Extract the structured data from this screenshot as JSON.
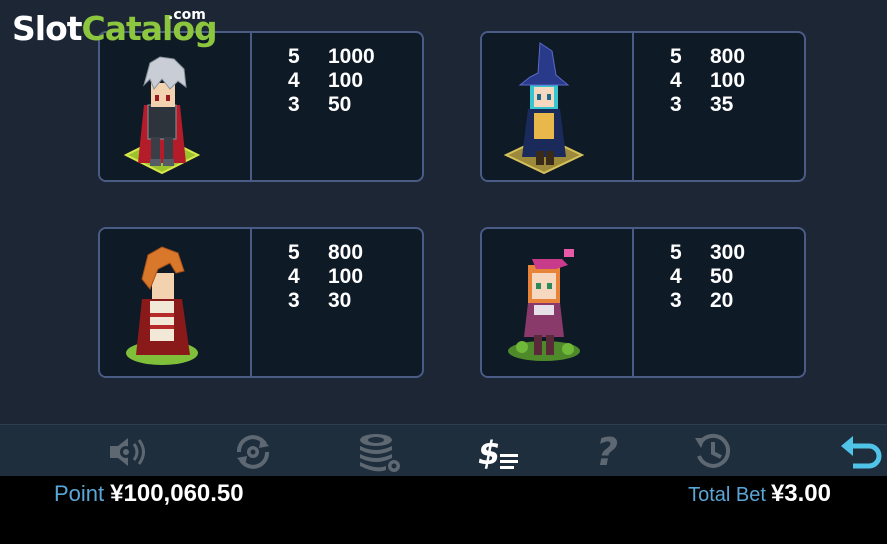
{
  "logo": {
    "slot": "Slot",
    "catalog": "Catalog",
    "com": ".com"
  },
  "symbols": [
    {
      "name": "silver-hair-knight",
      "pays": [
        {
          "count": "5",
          "value": "1000"
        },
        {
          "count": "4",
          "value": "100"
        },
        {
          "count": "3",
          "value": "50"
        }
      ]
    },
    {
      "name": "witch-girl",
      "pays": [
        {
          "count": "5",
          "value": "800"
        },
        {
          "count": "4",
          "value": "100"
        },
        {
          "count": "3",
          "value": "35"
        }
      ]
    },
    {
      "name": "orange-hair-warrior",
      "pays": [
        {
          "count": "5",
          "value": "800"
        },
        {
          "count": "4",
          "value": "100"
        },
        {
          "count": "3",
          "value": "30"
        }
      ]
    },
    {
      "name": "pink-hat-girl",
      "pays": [
        {
          "count": "5",
          "value": "300"
        },
        {
          "count": "4",
          "value": "50"
        },
        {
          "count": "3",
          "value": "20"
        }
      ]
    }
  ],
  "toolbar": {
    "icons": [
      "sound-settings-icon",
      "autoplay-icon",
      "bet-chips-icon",
      "paytable-icon",
      "help-icon",
      "history-icon",
      "back-icon"
    ],
    "help_glyph": "?"
  },
  "status": {
    "point_label": "Point",
    "point_value": "¥100,060.50",
    "total_bet_label": "Total Bet",
    "total_bet_value": "¥3.00"
  },
  "colors": {
    "background": "#1c2634",
    "card_border": "#4a5b86",
    "label_blue": "#5aa6d6",
    "logo_green": "#8cc63f",
    "back_icon": "#4fc3e8"
  }
}
